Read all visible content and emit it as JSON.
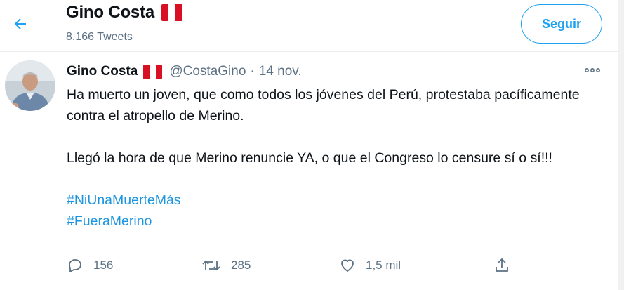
{
  "header": {
    "name": "Gino Costa",
    "tweet_count": "8.166 Tweets",
    "follow_label": "Seguir",
    "back_icon": "arrow-left-icon"
  },
  "colors": {
    "accent": "#1da1f2",
    "link": "#1b95e0",
    "muted": "#5b7083",
    "flag_red": "#d91023"
  },
  "tweet": {
    "author": "Gino Costa",
    "handle": "@CostaGino",
    "separator": "·",
    "date": "14 nov.",
    "paragraph1": "Ha muerto un joven, que como todos los jóvenes del Perú, protestaba pacíficamente contra el atropello de Merino.",
    "paragraph2": "Llegó la hora de que Merino renuncie YA, o que el Congreso lo censure sí o sí!!!",
    "hashtags": [
      "#NiUnaMuerteMás",
      "#FueraMerino"
    ],
    "actions": {
      "reply_count": "156",
      "retweet_count": "285",
      "like_count": "1,5 mil"
    }
  }
}
